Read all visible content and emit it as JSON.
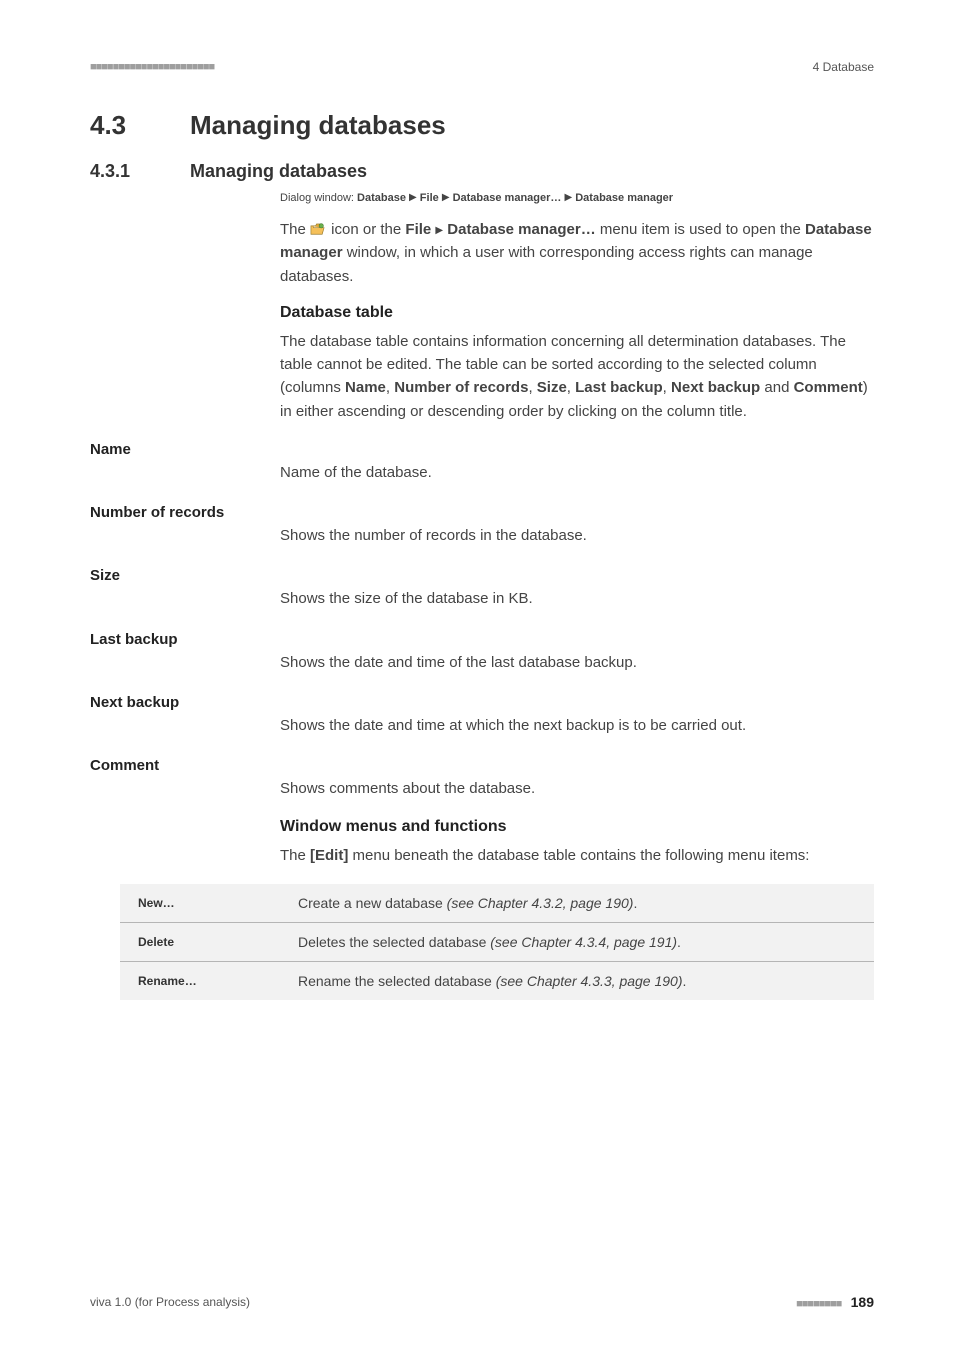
{
  "header": {
    "right": "4 Database"
  },
  "section": {
    "h1_num": "4.3",
    "h1_title": "Managing databases",
    "h2_num": "4.3.1",
    "h2_title": "Managing databases"
  },
  "dialog_path": {
    "prefix": "Dialog window: ",
    "p1": "Database",
    "p2": "File",
    "p3": "Database manager…",
    "p4": "Database manager"
  },
  "intro": {
    "pre_icon": "The ",
    "post_icon_1": " icon or the ",
    "file": "File",
    "dm": "Database manager…",
    "post_menu": " menu item is used to open the ",
    "dm_window": "Database manager",
    "tail": " window, in which a user with corresponding access rights can manage databases."
  },
  "db_table": {
    "heading": "Database table",
    "p1a": "The database table contains information concerning all determination databases. The table cannot be edited. The table can be sorted according to the selected column (columns ",
    "name": "Name",
    "comma1": ", ",
    "nor": "Number of records",
    "comma2": ", ",
    "size": "Size",
    "comma3": ", ",
    "last": "Last backup",
    "comma4": ", ",
    "next": "Next backup",
    "and": " and ",
    "comment": "Comment",
    "p1b": ") in either ascending or descending order by clicking on the column title."
  },
  "fields": [
    {
      "label": "Name",
      "desc": "Name of the database."
    },
    {
      "label": "Number of records",
      "desc": "Shows the number of records in the database."
    },
    {
      "label": "Size",
      "desc": "Shows the size of the database in KB."
    },
    {
      "label": "Last backup",
      "desc": "Shows the date and time of the last database backup."
    },
    {
      "label": "Next backup",
      "desc": "Shows the date and time at which the next backup is to be carried out."
    },
    {
      "label": "Comment",
      "desc": "Shows comments about the database."
    }
  ],
  "menus": {
    "heading": "Window menus and functions",
    "intro_a": "The ",
    "edit": "[Edit]",
    "intro_b": " menu beneath the database table contains the following menu items:"
  },
  "menu_table": [
    {
      "item": "New…",
      "desc_a": "Create a new database ",
      "desc_ref": "(see Chapter 4.3.2, page 190)",
      "desc_b": "."
    },
    {
      "item": "Delete",
      "desc_a": "Deletes the selected database ",
      "desc_ref": "(see Chapter 4.3.4, page 191)",
      "desc_b": "."
    },
    {
      "item": "Rename…",
      "desc_a": "Rename the selected database ",
      "desc_ref": "(see Chapter 4.3.3, page 190)",
      "desc_b": "."
    }
  ],
  "footer": {
    "left": "viva 1.0 (for Process analysis)",
    "page": "189"
  }
}
